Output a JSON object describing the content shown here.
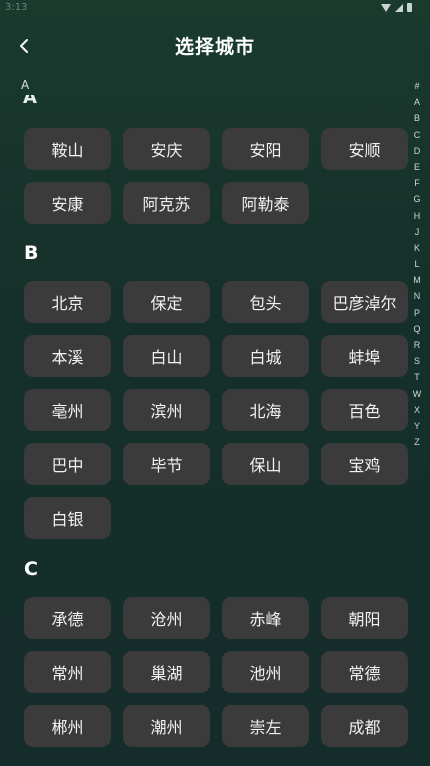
{
  "status_bar": {
    "time": "3:13"
  },
  "header": {
    "title": "选择城市"
  },
  "sticky_letter": "A",
  "peek_letter": "A",
  "sections": [
    {
      "letter": "A",
      "cities": [
        "鞍山",
        "安庆",
        "安阳",
        "安顺",
        "安康",
        "阿克苏",
        "阿勒泰"
      ]
    },
    {
      "letter": "B",
      "cities": [
        "北京",
        "保定",
        "包头",
        "巴彦淖尔",
        "本溪",
        "白山",
        "白城",
        "蚌埠",
        "亳州",
        "滨州",
        "北海",
        "百色",
        "巴中",
        "毕节",
        "保山",
        "宝鸡",
        "白银"
      ]
    },
    {
      "letter": "C",
      "cities": [
        "承德",
        "沧州",
        "赤峰",
        "朝阳",
        "常州",
        "巢湖",
        "池州",
        "常德",
        "郴州",
        "潮州",
        "崇左",
        "成都"
      ]
    }
  ],
  "alphabet_index": [
    "#",
    "A",
    "B",
    "C",
    "D",
    "E",
    "F",
    "G",
    "H",
    "J",
    "K",
    "L",
    "M",
    "N",
    "P",
    "Q",
    "R",
    "S",
    "T",
    "W",
    "X",
    "Y",
    "Z"
  ]
}
